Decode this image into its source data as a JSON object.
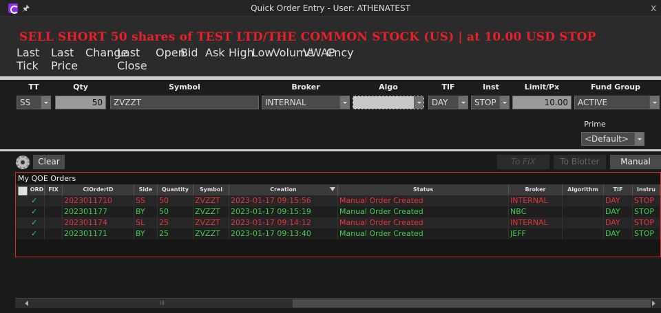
{
  "window": {
    "title": "Quick Order Entry - User: ATHENATEST",
    "close_glyph": "x",
    "pin_glyph": "🖈"
  },
  "banner": {
    "text": "SELL SHORT 50 shares of TEST LTD/THE COMMON STOCK (US) | at 10.00 USD STOP"
  },
  "quote_headers": [
    "Last Tick",
    "Last Price",
    "Change",
    "Last Close",
    "Open",
    "Bid",
    "Ask",
    "High",
    "Low",
    "Volume",
    "VWAP",
    "Cncy"
  ],
  "order_labels": {
    "tt": "TT",
    "qty": "Qty",
    "symbol": "Symbol",
    "broker": "Broker",
    "algo": "Algo",
    "tif": "TIF",
    "inst": "Inst",
    "limit": "Limit/Px",
    "fund_group": "Fund Group",
    "prime": "Prime"
  },
  "order_values": {
    "tt": "SS",
    "qty": "50",
    "symbol": "ZVZZT",
    "broker": "INTERNAL",
    "algo": "",
    "tif": "DAY",
    "inst": "STOP",
    "limit": "10.00",
    "fund_group": "ACTIVE",
    "prime": "<Default>"
  },
  "toolbar": {
    "clear": "Clear",
    "to_fix": "To FIX",
    "to_blotter": "To Blotter",
    "manual": "Manual"
  },
  "orders": {
    "title": "My QOE Orders",
    "headers": [
      "ORD",
      "FIX",
      "ClOrderID",
      "Side",
      "Quantity",
      "Symbol",
      "Creation",
      "Status",
      "Broker",
      "Algorithm",
      "TIF",
      "Instru"
    ],
    "rows": [
      {
        "ord": "✓",
        "fix": "",
        "id": "2023011710",
        "side": "SS",
        "qty": "50",
        "symbol": "ZVZZT",
        "creation": "2023-01-17 09:15:56",
        "status": "Manual Order Created",
        "broker": "INTERNAL",
        "algo": "",
        "tif": "DAY",
        "inst": "STOP",
        "color": "#e8323a"
      },
      {
        "ord": "✓",
        "fix": "",
        "id": "202301177",
        "side": "BY",
        "qty": "50",
        "symbol": "ZVZZT",
        "creation": "2023-01-17 09:15:19",
        "status": "Manual Order Created",
        "broker": "NBC",
        "algo": "",
        "tif": "DAY",
        "inst": "STOP",
        "color": "#3ecf4a"
      },
      {
        "ord": "✓",
        "fix": "",
        "id": "202301174",
        "side": "SL",
        "qty": "25",
        "symbol": "ZVZZT",
        "creation": "2023-01-17 09:14:12",
        "status": "Manual Order Created",
        "broker": "INTERNAL",
        "algo": "",
        "tif": "DAY",
        "inst": "STOP",
        "color": "#e8323a"
      },
      {
        "ord": "✓",
        "fix": "",
        "id": "202301171",
        "side": "BY",
        "qty": "25",
        "symbol": "ZVZZT",
        "creation": "2023-01-17 09:13:40",
        "status": "Manual Order Created",
        "broker": "JEFF",
        "algo": "",
        "tif": "DAY",
        "inst": "STOP",
        "color": "#3ecf4a"
      }
    ]
  },
  "scrollbar": {
    "grip": "III"
  },
  "colors": {
    "sell": "#e8323a",
    "buy": "#3ecf4a",
    "banner": "#e8202a"
  }
}
